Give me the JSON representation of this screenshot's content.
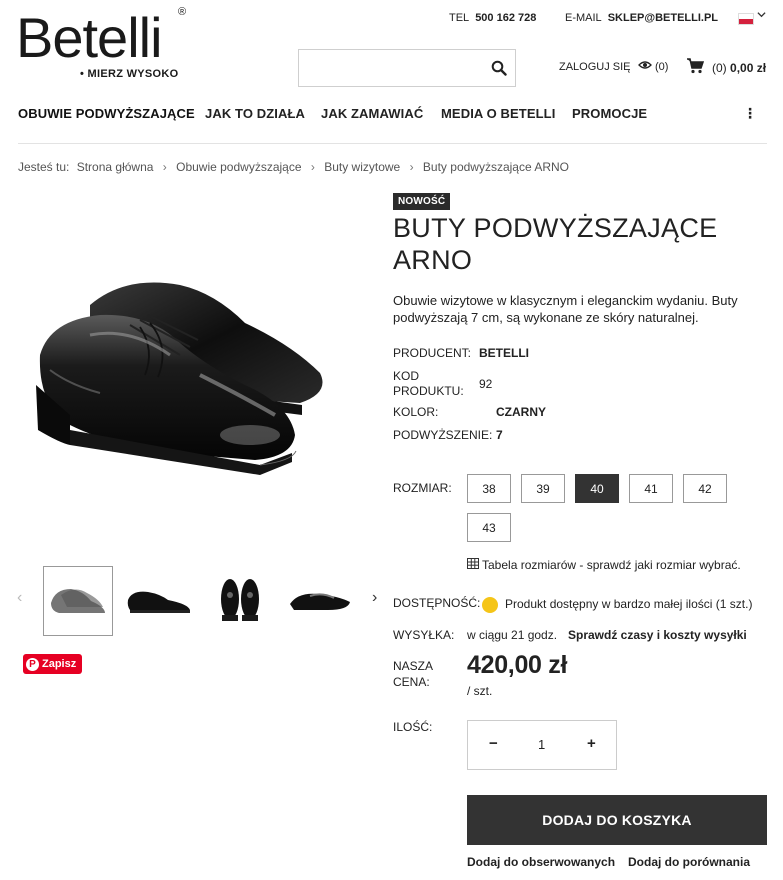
{
  "brand": {
    "name": "Betelli",
    "registered": "®",
    "tagline": "• MIERZ WYSOKO"
  },
  "contact": {
    "tel_label": "TEL",
    "tel_value": "500 162 728",
    "email_label": "E-MAIL",
    "email_value": "SKLEP@BETELLI.PL"
  },
  "search": {
    "placeholder": "",
    "value": ""
  },
  "account": {
    "login_label": "ZALOGUJ SIĘ",
    "watch_count": "(0)",
    "cart_count": "(0)",
    "cart_total": "0,00 zł"
  },
  "nav": {
    "items": [
      {
        "label": "OBUWIE PODWYŻSZAJĄCE"
      },
      {
        "label": "JAK TO DZIAŁA"
      },
      {
        "label": "JAK ZAMAWIAĆ"
      },
      {
        "label": "MEDIA O BETELLI"
      },
      {
        "label": "PROMOCJE"
      }
    ],
    "more": "⋮"
  },
  "breadcrumb": {
    "prefix": "Jesteś tu:",
    "items": [
      "Strona główna",
      "Obuwie podwyższające",
      "Buty wizytowe",
      "Buty podwyższające ARNO"
    ],
    "separator": "›"
  },
  "gallery": {
    "prev": "‹",
    "next": "›",
    "thumb_count": 4,
    "active_index": 0
  },
  "pinterest": {
    "label": "Zapisz"
  },
  "product": {
    "badge": "NOWOŚĆ",
    "title": "BUTY PODWYŻSZAJĄCE ARNO",
    "description": "Obuwie wizytowe w klasycznym i eleganckim wydaniu. Buty podwyższają 7 cm, są wykonane ze skóry naturalnej.",
    "specs": {
      "producer_label": "PRODUCENT:",
      "producer_value": "BETELLI",
      "code_label_line1": "KOD",
      "code_label_line2": "PRODUKTU:",
      "code_value": "92",
      "color_label": "KOLOR:",
      "color_value": "CZARNY",
      "lift_label": "PODWYŻSZENIE:",
      "lift_value": "7"
    },
    "size_label": "ROZMIAR:",
    "sizes": [
      "38",
      "39",
      "40",
      "41",
      "42",
      "43"
    ],
    "selected_size": "40",
    "size_table_text": "Tabela rozmiarów - sprawdź jaki rozmiar wybrać.",
    "availability_label": "DOSTĘPNOŚĆ:",
    "availability_text": "Produkt dostępny w bardzo małej ilości (1 szt.)",
    "availability_color": "#f5c518",
    "shipping_label": "WYSYŁKA:",
    "shipping_time": "w ciągu 21 godz.",
    "shipping_link": "Sprawdź czasy i koszty wysyłki",
    "price_label_line1": "NASZA",
    "price_label_line2": "CENA:",
    "price": "420,00 zł",
    "price_unit": "/ szt.",
    "qty_label": "ILOŚĆ:",
    "qty_minus": "−",
    "qty_value": "1",
    "qty_plus": "+",
    "add_to_cart": "DODAJ DO KOSZYKA",
    "add_watch": "Dodaj do obserwowanych",
    "add_compare": "Dodaj do porównania"
  },
  "colors": {
    "dark": "#333333",
    "pinterest": "#e60023",
    "flag_red": "#d4213d"
  }
}
